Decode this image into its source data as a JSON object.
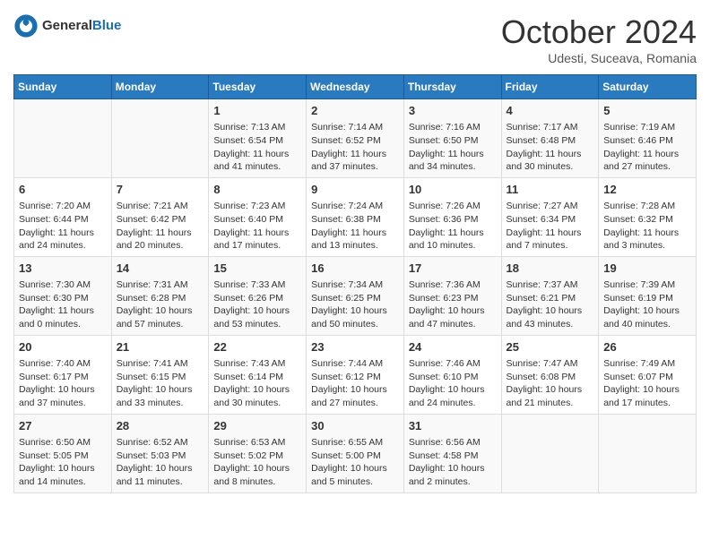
{
  "header": {
    "logo_general": "General",
    "logo_blue": "Blue",
    "month": "October 2024",
    "location": "Udesti, Suceava, Romania"
  },
  "days_of_week": [
    "Sunday",
    "Monday",
    "Tuesday",
    "Wednesday",
    "Thursday",
    "Friday",
    "Saturday"
  ],
  "weeks": [
    [
      {
        "day": "",
        "info": ""
      },
      {
        "day": "",
        "info": ""
      },
      {
        "day": "1",
        "info": "Sunrise: 7:13 AM\nSunset: 6:54 PM\nDaylight: 11 hours and 41 minutes."
      },
      {
        "day": "2",
        "info": "Sunrise: 7:14 AM\nSunset: 6:52 PM\nDaylight: 11 hours and 37 minutes."
      },
      {
        "day": "3",
        "info": "Sunrise: 7:16 AM\nSunset: 6:50 PM\nDaylight: 11 hours and 34 minutes."
      },
      {
        "day": "4",
        "info": "Sunrise: 7:17 AM\nSunset: 6:48 PM\nDaylight: 11 hours and 30 minutes."
      },
      {
        "day": "5",
        "info": "Sunrise: 7:19 AM\nSunset: 6:46 PM\nDaylight: 11 hours and 27 minutes."
      }
    ],
    [
      {
        "day": "6",
        "info": "Sunrise: 7:20 AM\nSunset: 6:44 PM\nDaylight: 11 hours and 24 minutes."
      },
      {
        "day": "7",
        "info": "Sunrise: 7:21 AM\nSunset: 6:42 PM\nDaylight: 11 hours and 20 minutes."
      },
      {
        "day": "8",
        "info": "Sunrise: 7:23 AM\nSunset: 6:40 PM\nDaylight: 11 hours and 17 minutes."
      },
      {
        "day": "9",
        "info": "Sunrise: 7:24 AM\nSunset: 6:38 PM\nDaylight: 11 hours and 13 minutes."
      },
      {
        "day": "10",
        "info": "Sunrise: 7:26 AM\nSunset: 6:36 PM\nDaylight: 11 hours and 10 minutes."
      },
      {
        "day": "11",
        "info": "Sunrise: 7:27 AM\nSunset: 6:34 PM\nDaylight: 11 hours and 7 minutes."
      },
      {
        "day": "12",
        "info": "Sunrise: 7:28 AM\nSunset: 6:32 PM\nDaylight: 11 hours and 3 minutes."
      }
    ],
    [
      {
        "day": "13",
        "info": "Sunrise: 7:30 AM\nSunset: 6:30 PM\nDaylight: 11 hours and 0 minutes."
      },
      {
        "day": "14",
        "info": "Sunrise: 7:31 AM\nSunset: 6:28 PM\nDaylight: 10 hours and 57 minutes."
      },
      {
        "day": "15",
        "info": "Sunrise: 7:33 AM\nSunset: 6:26 PM\nDaylight: 10 hours and 53 minutes."
      },
      {
        "day": "16",
        "info": "Sunrise: 7:34 AM\nSunset: 6:25 PM\nDaylight: 10 hours and 50 minutes."
      },
      {
        "day": "17",
        "info": "Sunrise: 7:36 AM\nSunset: 6:23 PM\nDaylight: 10 hours and 47 minutes."
      },
      {
        "day": "18",
        "info": "Sunrise: 7:37 AM\nSunset: 6:21 PM\nDaylight: 10 hours and 43 minutes."
      },
      {
        "day": "19",
        "info": "Sunrise: 7:39 AM\nSunset: 6:19 PM\nDaylight: 10 hours and 40 minutes."
      }
    ],
    [
      {
        "day": "20",
        "info": "Sunrise: 7:40 AM\nSunset: 6:17 PM\nDaylight: 10 hours and 37 minutes."
      },
      {
        "day": "21",
        "info": "Sunrise: 7:41 AM\nSunset: 6:15 PM\nDaylight: 10 hours and 33 minutes."
      },
      {
        "day": "22",
        "info": "Sunrise: 7:43 AM\nSunset: 6:14 PM\nDaylight: 10 hours and 30 minutes."
      },
      {
        "day": "23",
        "info": "Sunrise: 7:44 AM\nSunset: 6:12 PM\nDaylight: 10 hours and 27 minutes."
      },
      {
        "day": "24",
        "info": "Sunrise: 7:46 AM\nSunset: 6:10 PM\nDaylight: 10 hours and 24 minutes."
      },
      {
        "day": "25",
        "info": "Sunrise: 7:47 AM\nSunset: 6:08 PM\nDaylight: 10 hours and 21 minutes."
      },
      {
        "day": "26",
        "info": "Sunrise: 7:49 AM\nSunset: 6:07 PM\nDaylight: 10 hours and 17 minutes."
      }
    ],
    [
      {
        "day": "27",
        "info": "Sunrise: 6:50 AM\nSunset: 5:05 PM\nDaylight: 10 hours and 14 minutes."
      },
      {
        "day": "28",
        "info": "Sunrise: 6:52 AM\nSunset: 5:03 PM\nDaylight: 10 hours and 11 minutes."
      },
      {
        "day": "29",
        "info": "Sunrise: 6:53 AM\nSunset: 5:02 PM\nDaylight: 10 hours and 8 minutes."
      },
      {
        "day": "30",
        "info": "Sunrise: 6:55 AM\nSunset: 5:00 PM\nDaylight: 10 hours and 5 minutes."
      },
      {
        "day": "31",
        "info": "Sunrise: 6:56 AM\nSunset: 4:58 PM\nDaylight: 10 hours and 2 minutes."
      },
      {
        "day": "",
        "info": ""
      },
      {
        "day": "",
        "info": ""
      }
    ]
  ]
}
